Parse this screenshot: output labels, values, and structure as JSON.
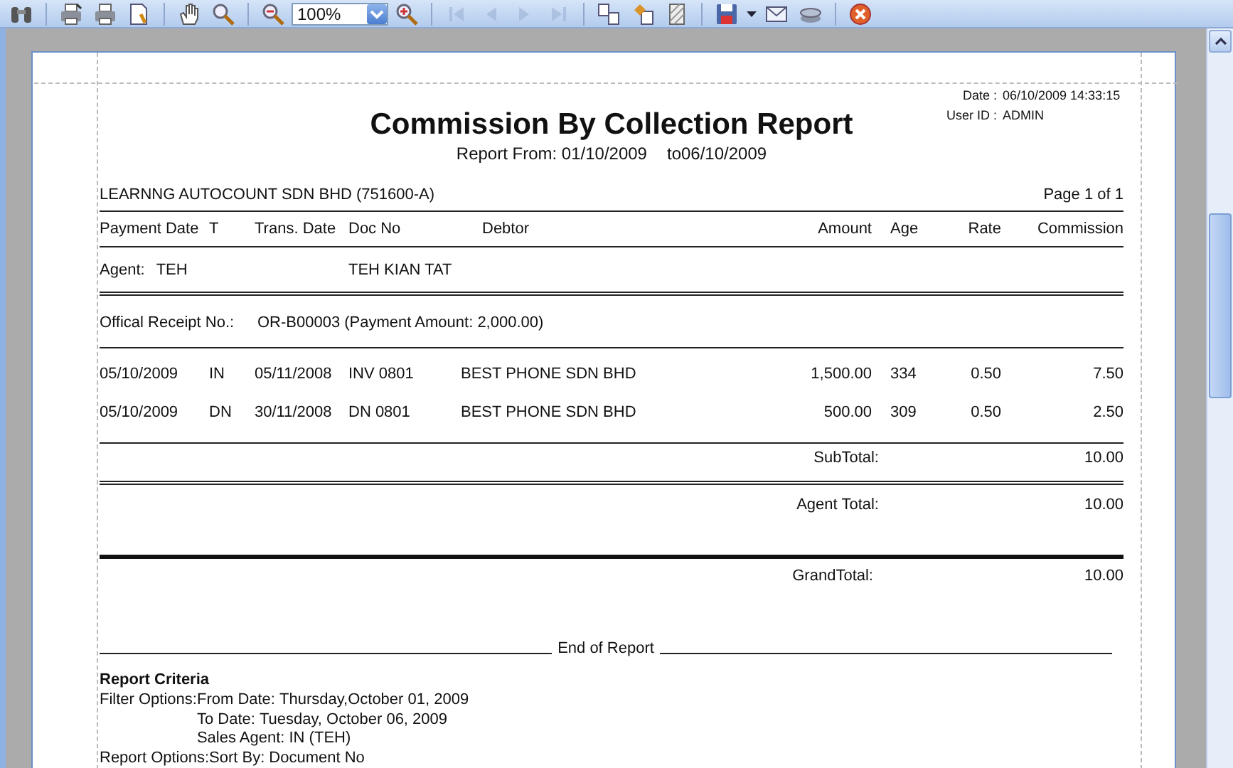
{
  "toolbar": {
    "groups": [
      [
        {
          "kind": "find",
          "disabled": false
        }
      ],
      [
        {
          "kind": "print-setup",
          "disabled": false
        },
        {
          "kind": "print",
          "disabled": false
        },
        {
          "kind": "page-setup",
          "disabled": false
        }
      ],
      [
        {
          "kind": "hand",
          "disabled": false
        },
        {
          "kind": "magnifier",
          "disabled": false
        }
      ],
      [
        {
          "kind": "zoom-out",
          "disabled": false
        },
        {
          "kind": "zoom",
          "disabled": false,
          "value": "100%"
        },
        {
          "kind": "zoom-in",
          "disabled": false
        }
      ],
      [
        {
          "kind": "first",
          "disabled": true
        },
        {
          "kind": "prev",
          "disabled": true
        },
        {
          "kind": "next",
          "disabled": true
        },
        {
          "kind": "last",
          "disabled": true
        }
      ],
      [
        {
          "kind": "multipage",
          "disabled": false
        },
        {
          "kind": "background",
          "disabled": false
        },
        {
          "kind": "watermark",
          "disabled": false
        }
      ],
      [
        {
          "kind": "save",
          "disabled": false
        },
        {
          "kind": "dropdown",
          "disabled": false
        },
        {
          "kind": "email",
          "disabled": false
        },
        {
          "kind": "export",
          "disabled": false
        }
      ],
      [
        {
          "kind": "close",
          "disabled": false
        }
      ]
    ]
  },
  "report": {
    "meta": [
      {
        "label": "Date :",
        "value": "06/10/2009 14:33:15"
      },
      {
        "label": "User ID :",
        "value": "ADMIN"
      }
    ],
    "title": "Commission By Collection Report",
    "range_from": "Report From: 01/10/2009",
    "range_to": "to06/10/2009",
    "company": "LEARNNG AUTOCOUNT SDN BHD (751600-A)",
    "page": "Page 1 of 1",
    "columns": [
      "Payment Date",
      "T",
      "Trans. Date",
      "Doc No",
      "Debtor",
      "Amount",
      "Age",
      "Rate",
      "Commission"
    ],
    "agent": {
      "label": "Agent:",
      "code": "TEH",
      "name": "TEH KIAN TAT"
    },
    "receipt": {
      "label": "Offical Receipt No.:",
      "value": "OR-B00003 (Payment Amount: 2,000.00)"
    },
    "rows": [
      [
        "05/10/2009",
        "IN",
        "05/11/2008",
        "INV 0801",
        "BEST PHONE SDN BHD",
        "1,500.00",
        "334",
        "0.50",
        "7.50"
      ],
      [
        "05/10/2009",
        "DN",
        "30/11/2008",
        "DN 0801",
        "BEST PHONE SDN BHD",
        "500.00",
        "309",
        "0.50",
        "2.50"
      ]
    ],
    "subtotal": {
      "label": "SubTotal:",
      "value": "10.00"
    },
    "agent_total": {
      "label": "Agent Total:",
      "value": "10.00"
    },
    "grand_total": {
      "label": "GrandTotal:",
      "value": "10.00"
    },
    "end": "End of Report",
    "criteria": {
      "title": "Report Criteria",
      "groups": [
        {
          "label": "Filter Options:",
          "items": [
            {
              "label": "From Date:",
              "value": "Thursday,October 01, 2009"
            },
            {
              "label": "To Date:",
              "value": "Tuesday, October 06, 2009"
            },
            {
              "label": "Sales Agent:",
              "value": "IN (TEH)"
            }
          ]
        },
        {
          "label": "Report Options:",
          "items": [
            {
              "label": "Sort By:",
              "value": "Document No"
            }
          ]
        }
      ]
    }
  }
}
